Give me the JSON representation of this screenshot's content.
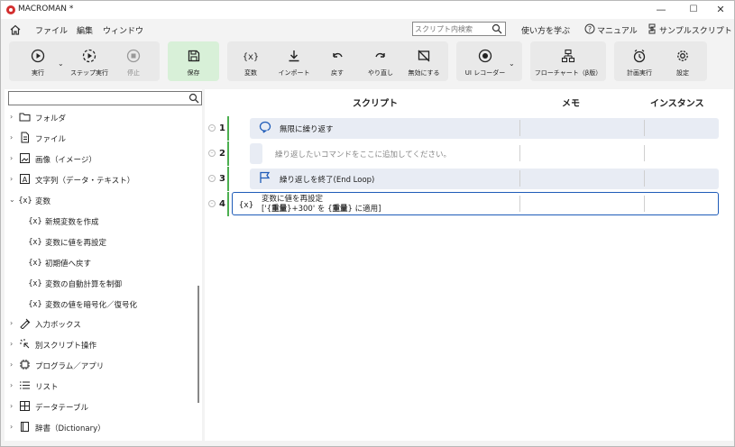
{
  "window": {
    "title": "MACROMAN *",
    "minimize": "—",
    "maximize": "☐",
    "close": "✕"
  },
  "menu": {
    "file": "ファイル",
    "edit": "編集",
    "window": "ウィンドウ"
  },
  "search": {
    "placeholder": "スクリプト内検索"
  },
  "help": {
    "learn": "使い方を学ぶ",
    "manual": "マニュアル",
    "samples": "サンプルスクリプト"
  },
  "toolbar": {
    "run": "実行",
    "step_run": "ステップ実行",
    "stop": "停止",
    "save": "保存",
    "variable": "変数",
    "import": "インポート",
    "undo": "戻す",
    "redo": "やり直し",
    "disable": "無効にする",
    "ui_recorder": "UI レコーダー",
    "flowchart": "フローチャート（β版）",
    "schedule": "計画実行",
    "settings": "設定"
  },
  "tree": [
    {
      "label": "フォルダ",
      "icon": "folder-icon",
      "level": 0,
      "expanded": false
    },
    {
      "label": "ファイル",
      "icon": "file-icon",
      "level": 0,
      "expanded": false
    },
    {
      "label": "画像（イメージ）",
      "icon": "image-icon",
      "level": 0,
      "expanded": false
    },
    {
      "label": "文字列（データ・テキスト）",
      "icon": "text-icon",
      "level": 0,
      "expanded": false
    },
    {
      "label": "変数",
      "icon": "variable-icon",
      "level": 0,
      "expanded": true
    },
    {
      "label": "新規変数を作成",
      "icon": "variable-icon",
      "level": 1
    },
    {
      "label": "変数に値を再設定",
      "icon": "variable-icon",
      "level": 1
    },
    {
      "label": "初期値へ戻す",
      "icon": "variable-icon",
      "level": 1
    },
    {
      "label": "変数の自動計算を制御",
      "icon": "variable-icon",
      "level": 1
    },
    {
      "label": "変数の値を暗号化／復号化",
      "icon": "variable-icon",
      "level": 1
    },
    {
      "label": "入力ボックス",
      "icon": "input-box-icon",
      "level": 0,
      "expanded": false
    },
    {
      "label": "別スクリプト操作",
      "icon": "script-op-icon",
      "level": 0,
      "expanded": false
    },
    {
      "label": "プログラム／アプリ",
      "icon": "program-icon",
      "level": 0,
      "expanded": false
    },
    {
      "label": "リスト",
      "icon": "list-icon",
      "level": 0,
      "expanded": false
    },
    {
      "label": "データテーブル",
      "icon": "datatable-icon",
      "level": 0,
      "expanded": false
    },
    {
      "label": "辞書（Dictionary）",
      "icon": "dictionary-icon",
      "level": 0,
      "expanded": false
    }
  ],
  "columns": {
    "script": "スクリプト",
    "memo": "メモ",
    "instance": "インスタンス"
  },
  "rows": [
    {
      "num": "1",
      "text": "無限に繰り返す",
      "icon": "loop-icon"
    },
    {
      "num": "2",
      "text": "繰り返したいコマンドをここに追加してください。"
    },
    {
      "num": "3",
      "text": "繰り返しを終了(End Loop)",
      "icon": "flag-icon"
    },
    {
      "num": "4",
      "line1": "変数に値を再設定",
      "line2_pre": "['{",
      "line2_var1": "重量",
      "line2_mid": "}+300' を {",
      "line2_var2": "重量",
      "line2_post": "} に適用]",
      "icon": "variable-icon"
    }
  ],
  "colors": {
    "accent": "#1e5bb8",
    "indicator": "#4caf50",
    "save_bg": "#d8f0d8"
  }
}
